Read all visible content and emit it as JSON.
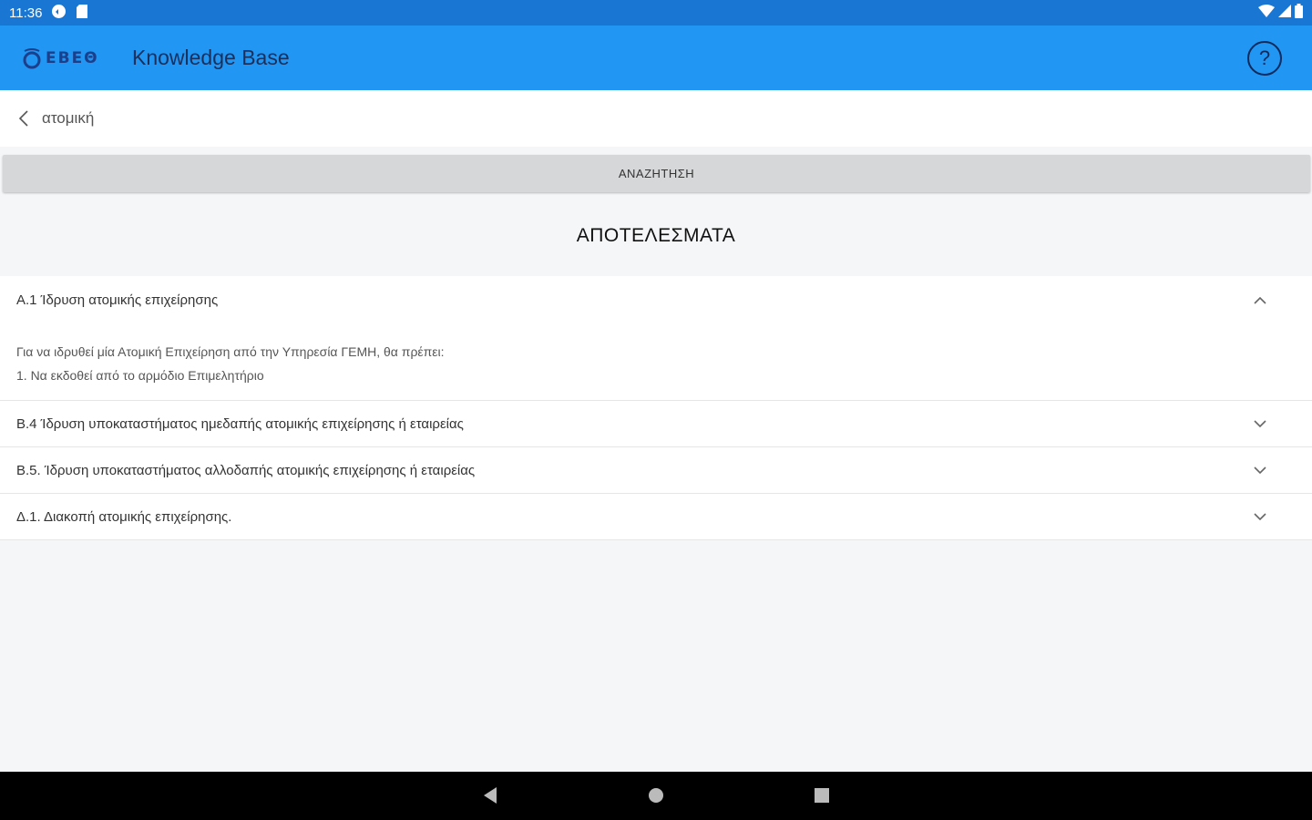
{
  "status_bar": {
    "time": "11:36",
    "icons": [
      "shield-icon",
      "sdcard-icon",
      "wifi-icon",
      "signal-icon",
      "battery-icon"
    ]
  },
  "app_bar": {
    "logo_text": "ΕΒΕΘ",
    "title": "Knowledge Base",
    "help_icon": "?",
    "color": "#2196f3"
  },
  "search": {
    "query": "ατομική",
    "button_label": "ΑΝΑΖΗΤΗΣΗ"
  },
  "results": {
    "heading": "ΑΠΟΤΕΛΕΣΜΑΤΑ",
    "items": [
      {
        "title": "Α.1 Ίδρυση ατομικής επιχείρησης",
        "expanded": true,
        "body_line1": "Για να ιδρυθεί μία Ατομική Επιχείρηση από την Υπηρεσία ΓΕΜΗ, θα πρέπει:",
        "body_line2": "1. Να εκδοθεί από το αρμόδιο Επιμελητήριο"
      },
      {
        "title": "Β.4 Ίδρυση υποκαταστήματος ημεδαπής ατομικής επιχείρησης ή εταιρείας",
        "expanded": false
      },
      {
        "title": "Β.5. Ίδρυση υποκαταστήματος αλλοδαπής ατομικής επιχείρησης ή εταιρείας",
        "expanded": false
      },
      {
        "title": "Δ.1. Διακοπή ατομικής επιχείρησης.",
        "expanded": false
      }
    ]
  },
  "nav_bar": {
    "icons": [
      "back-triangle-icon",
      "home-circle-icon",
      "recents-square-icon"
    ]
  }
}
